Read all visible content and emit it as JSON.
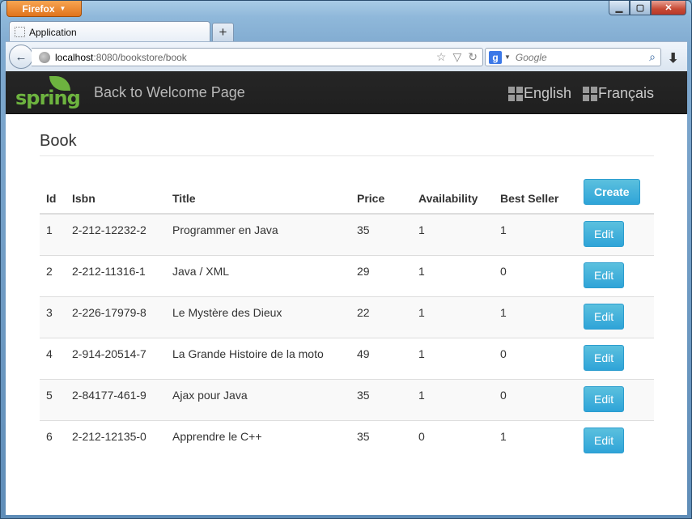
{
  "browser": {
    "app_button": "Firefox",
    "tab_title": "Application",
    "url_host": "localhost",
    "url_rest": ":8080/bookstore/book",
    "search_placeholder": "Google"
  },
  "header": {
    "brand": "spring",
    "back_link": "Back to Welcome Page",
    "lang_en": "English",
    "lang_fr": "Français"
  },
  "page": {
    "title": "Book",
    "columns": [
      "Id",
      "Isbn",
      "Title",
      "Price",
      "Availability",
      "Best Seller"
    ],
    "create_label": "Create",
    "edit_label": "Edit",
    "rows": [
      [
        "1",
        "2-212-12232-2",
        "Programmer en Java",
        "35",
        "1",
        "1"
      ],
      [
        "2",
        "2-212-11316-1",
        "Java / XML",
        "29",
        "1",
        "0"
      ],
      [
        "3",
        "2-226-17979-8",
        "Le Mystère des Dieux",
        "22",
        "1",
        "1"
      ],
      [
        "4",
        "2-914-20514-7",
        "La Grande Histoire de la moto",
        "49",
        "1",
        "0"
      ],
      [
        "5",
        "2-84177-461-9",
        "Ajax pour Java",
        "35",
        "1",
        "0"
      ],
      [
        "6",
        "2-212-12135-0",
        "Apprendre le C++",
        "35",
        "0",
        "1"
      ]
    ]
  },
  "colors": {
    "spring_green": "#6db33f",
    "button_blue": "#2fa4d8",
    "topbar": "#222222"
  }
}
